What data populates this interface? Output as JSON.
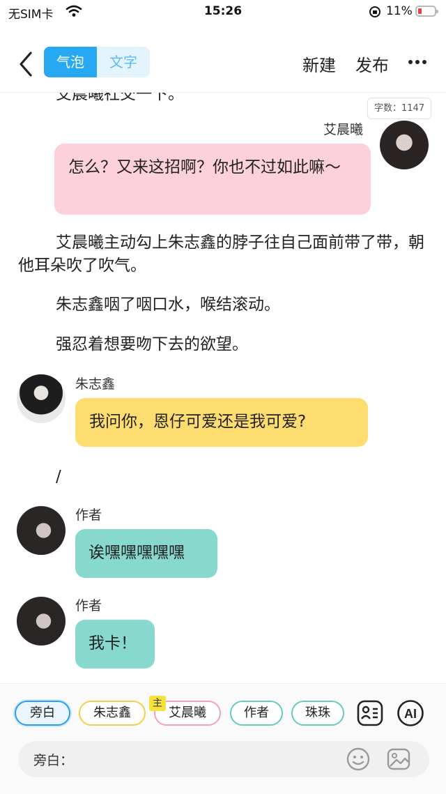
{
  "status_bar": {
    "carrier": "无SIM卡",
    "time": "15:26",
    "battery": "11%"
  },
  "nav": {
    "tab_bubble": "气泡",
    "tab_text": "文字",
    "new_label": "新建",
    "publish_label": "发布",
    "more_icon": "more-icon"
  },
  "content": {
    "cut_line": "艾晨曦社交一下。",
    "word_count": "字数：1147",
    "msg1": {
      "name": "艾晨曦",
      "text": "怎么？又来这招啊？你也不过如此嘛～",
      "color": "#fdd1dc"
    },
    "narration1": "艾晨曦主动勾上朱志鑫的脖子往自己面前带了带，朝他耳朵吹了吹气。",
    "narration2": "朱志鑫咽了咽口水，喉结滚动。",
    "narration3": "强忍着想要吻下去的欲望。",
    "msg2": {
      "name": "朱志鑫",
      "text": "我问你，恩仔可爱还是我可爱?",
      "color": "#fddd6f"
    },
    "slash": "/",
    "msg3": {
      "name": "作者",
      "text": "诶嘿嘿嘿嘿嘿",
      "color": "#86d9cc"
    },
    "msg4": {
      "name": "作者",
      "text": "我卡！",
      "color": "#86d9cc"
    }
  },
  "bottom": {
    "chips": [
      {
        "label": "旁白",
        "border": "#2c9ee8"
      },
      {
        "label": "朱志鑫",
        "border": "#f2d04a"
      },
      {
        "label": "艾晨曦",
        "border": "#f3a3b8",
        "badge": "主"
      },
      {
        "label": "作者",
        "border": "#64cbbd"
      },
      {
        "label": "珠珠",
        "border": "#64cbbd"
      }
    ],
    "input_label": "旁白："
  },
  "colors": {
    "accent": "#27a8f2"
  }
}
